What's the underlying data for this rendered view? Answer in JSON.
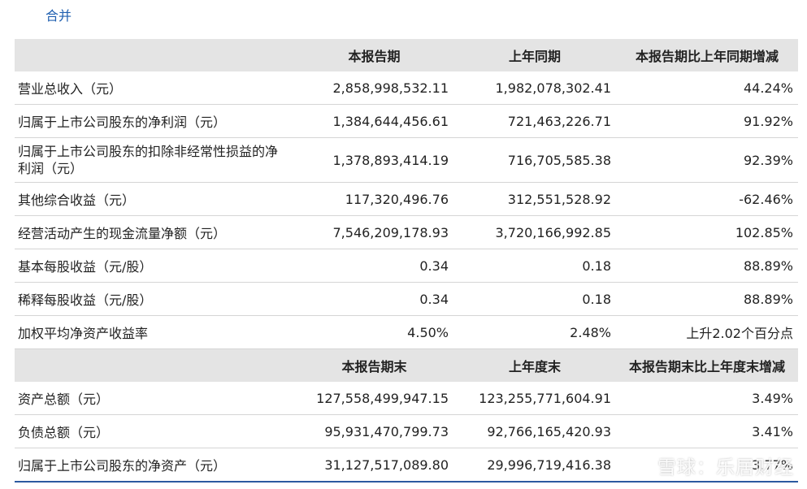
{
  "title": "合并",
  "header1": [
    "",
    "本报告期",
    "上年同期",
    "本报告期比上年同期增减"
  ],
  "rows1": [
    [
      "营业总收入（元）",
      "2,858,998,532.11",
      "1,982,078,302.41",
      "44.24%"
    ],
    [
      "归属于上市公司股东的净利润（元）",
      "1,384,644,456.61",
      "721,463,226.71",
      "91.92%"
    ],
    [
      "归属于上市公司股东的扣除非经常性损益的净利润（元）",
      "1,378,893,414.19",
      "716,705,585.38",
      "92.39%"
    ],
    [
      "其他综合收益（元）",
      "117,320,496.76",
      "312,551,528.92",
      "-62.46%"
    ],
    [
      "经营活动产生的现金流量净额（元）",
      "7,546,209,178.93",
      "3,720,166,992.85",
      "102.85%"
    ],
    [
      "基本每股收益（元/股）",
      "0.34",
      "0.18",
      "88.89%"
    ],
    [
      "稀释每股收益（元/股）",
      "0.34",
      "0.18",
      "88.89%"
    ],
    [
      "加权平均净资产收益率",
      "4.50%",
      "2.48%",
      "上升2.02个百分点"
    ]
  ],
  "header2": [
    "",
    "本报告期末",
    "上年度末",
    "本报告期末比上年度末增减"
  ],
  "rows2": [
    [
      "资产总额（元）",
      "127,558,499,947.15",
      "123,255,771,604.91",
      "3.49%"
    ],
    [
      "负债总额（元）",
      "95,931,470,799.73",
      "92,766,165,420.93",
      "3.41%"
    ],
    [
      "归属于上市公司股东的净资产（元）",
      "31,127,517,089.80",
      "29,996,719,416.38",
      "3.77%"
    ]
  ],
  "watermark": "雪球：乐居财经"
}
